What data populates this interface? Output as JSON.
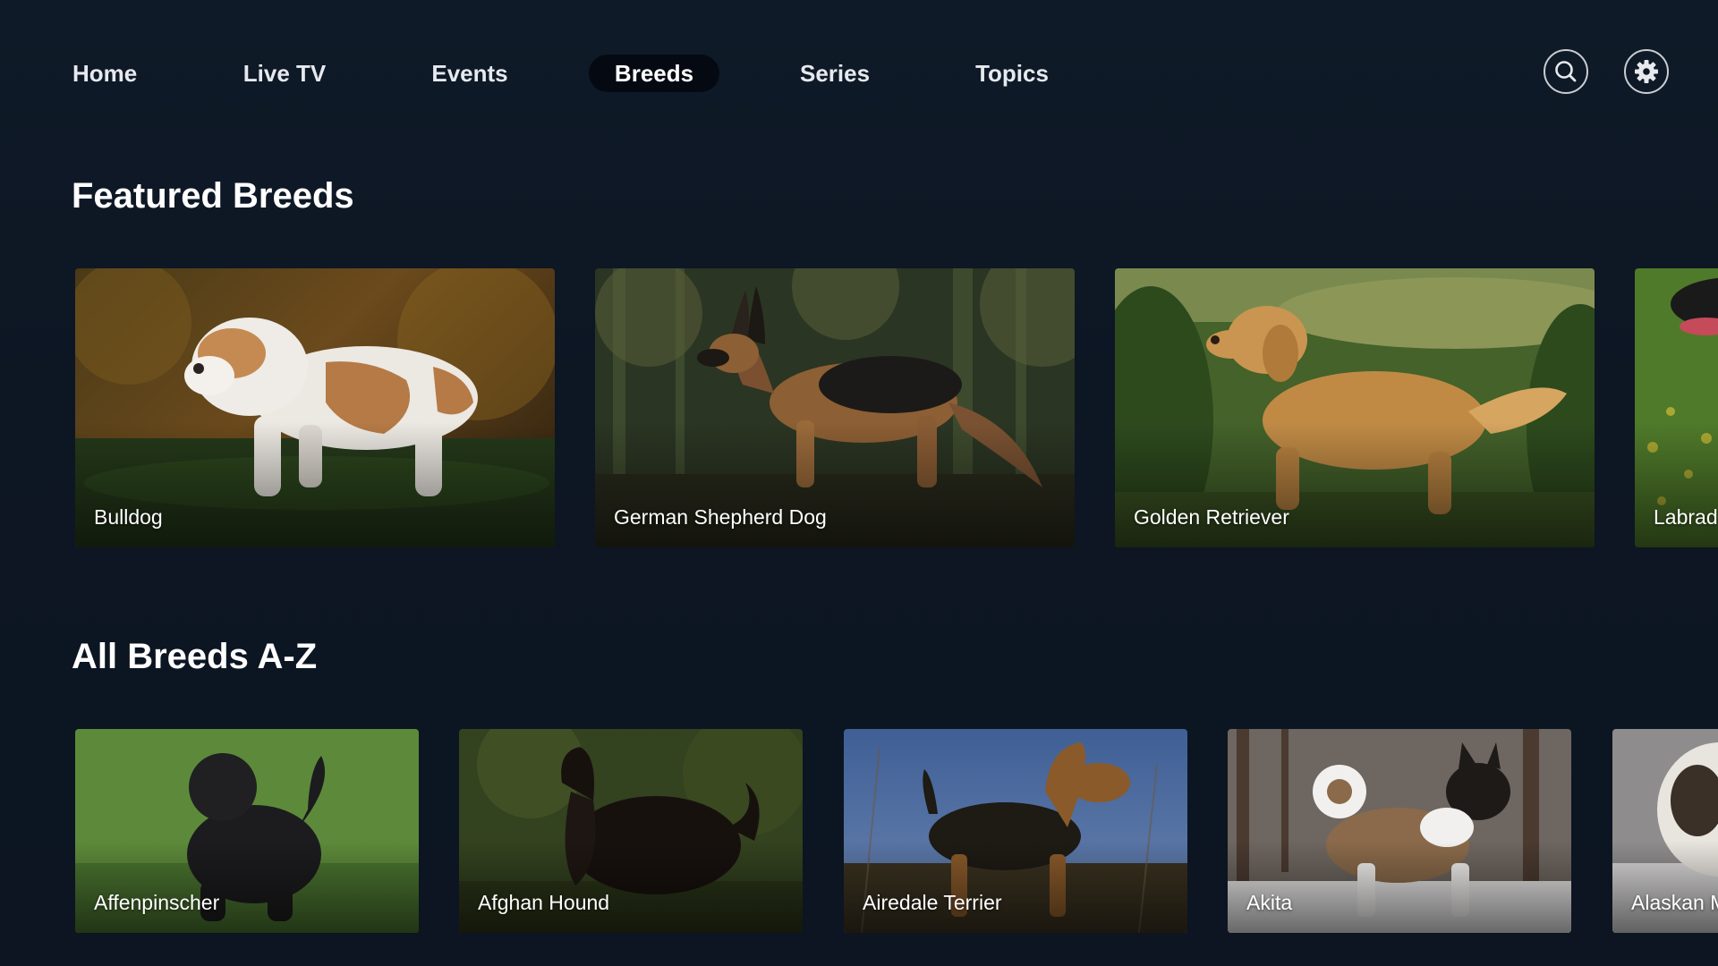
{
  "nav": {
    "tabs": [
      {
        "label": "Home",
        "active": false
      },
      {
        "label": "Live TV",
        "active": false
      },
      {
        "label": "Events",
        "active": false
      },
      {
        "label": "Breeds",
        "active": true
      },
      {
        "label": "Series",
        "active": false
      },
      {
        "label": "Topics",
        "active": false
      }
    ],
    "icons": [
      "search-icon",
      "gear-icon"
    ]
  },
  "featured": {
    "title": "Featured Breeds",
    "cards": [
      {
        "label": "Bulldog"
      },
      {
        "label": "German Shepherd Dog"
      },
      {
        "label": "Golden Retriever"
      },
      {
        "label": "Labrad"
      }
    ]
  },
  "all_breeds": {
    "title": "All Breeds A-Z",
    "cards": [
      {
        "label": "Affenpinscher"
      },
      {
        "label": "Afghan Hound"
      },
      {
        "label": "Airedale Terrier"
      },
      {
        "label": "Akita"
      },
      {
        "label": "Alaskan M"
      }
    ]
  },
  "colors": {
    "background": "#0d1623",
    "active_tab_bg": "#050a12",
    "text": "#ffffff"
  }
}
